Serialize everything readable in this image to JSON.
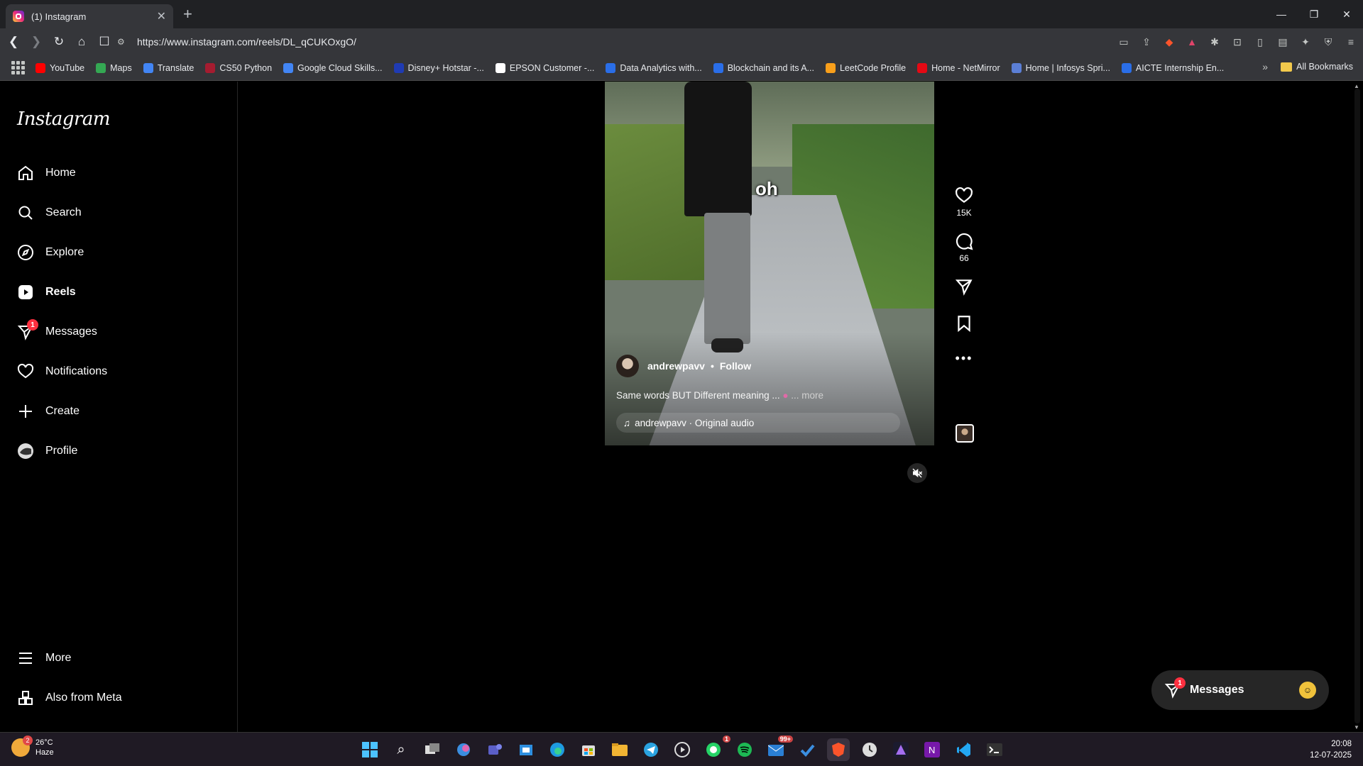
{
  "browser": {
    "tab_title": "(1) Instagram",
    "url": "https://www.instagram.com/reels/DL_qCUKOxgO/",
    "bookmarks": [
      {
        "label": "YouTube",
        "color": "#ff0000"
      },
      {
        "label": "Maps",
        "color": "#34a853"
      },
      {
        "label": "Translate",
        "color": "#4285f4"
      },
      {
        "label": "CS50 Python",
        "color": "#a51c30"
      },
      {
        "label": "Google Cloud Skills...",
        "color": "#4285f4"
      },
      {
        "label": "Disney+ Hotstar -...",
        "color": "#1f3bb3"
      },
      {
        "label": "EPSON Customer -...",
        "color": "#ffffff"
      },
      {
        "label": "Data Analytics with...",
        "color": "#2a6ee8"
      },
      {
        "label": "Blockchain and its A...",
        "color": "#2a6ee8"
      },
      {
        "label": "LeetCode Profile",
        "color": "#f89f1b"
      },
      {
        "label": "Home - NetMirror",
        "color": "#e50914"
      },
      {
        "label": "Home | Infosys Spri...",
        "color": "#5b7fd6"
      },
      {
        "label": "AICTE Internship En...",
        "color": "#2a6ee8"
      }
    ],
    "all_bookmarks": "All Bookmarks"
  },
  "sidebar": {
    "logo": "Instagram",
    "items": [
      {
        "label": "Home"
      },
      {
        "label": "Search"
      },
      {
        "label": "Explore"
      },
      {
        "label": "Reels"
      },
      {
        "label": "Messages",
        "badge": "1"
      },
      {
        "label": "Notifications"
      },
      {
        "label": "Create"
      },
      {
        "label": "Profile"
      }
    ],
    "bottom": [
      {
        "label": "More"
      },
      {
        "label": "Also from Meta"
      }
    ]
  },
  "reel": {
    "overlay_word": "oh",
    "username": "andrewpavv",
    "follow": "Follow",
    "caption": "Same words BUT Different meaning ...",
    "more": "... more",
    "audio": "andrewpavv · Original audio",
    "likes": "15K",
    "comments": "66"
  },
  "messages_pill": {
    "label": "Messages",
    "badge": "1"
  },
  "taskbar": {
    "temperature": "26°C",
    "condition": "Haze",
    "weather_badge": "2",
    "time": "20:08",
    "date": "12-07-2025",
    "whatsapp_badge": "1",
    "mail_badge": "99+"
  },
  "colors": {
    "accent_badge": "#ff3040",
    "page_bg": "#000000"
  }
}
